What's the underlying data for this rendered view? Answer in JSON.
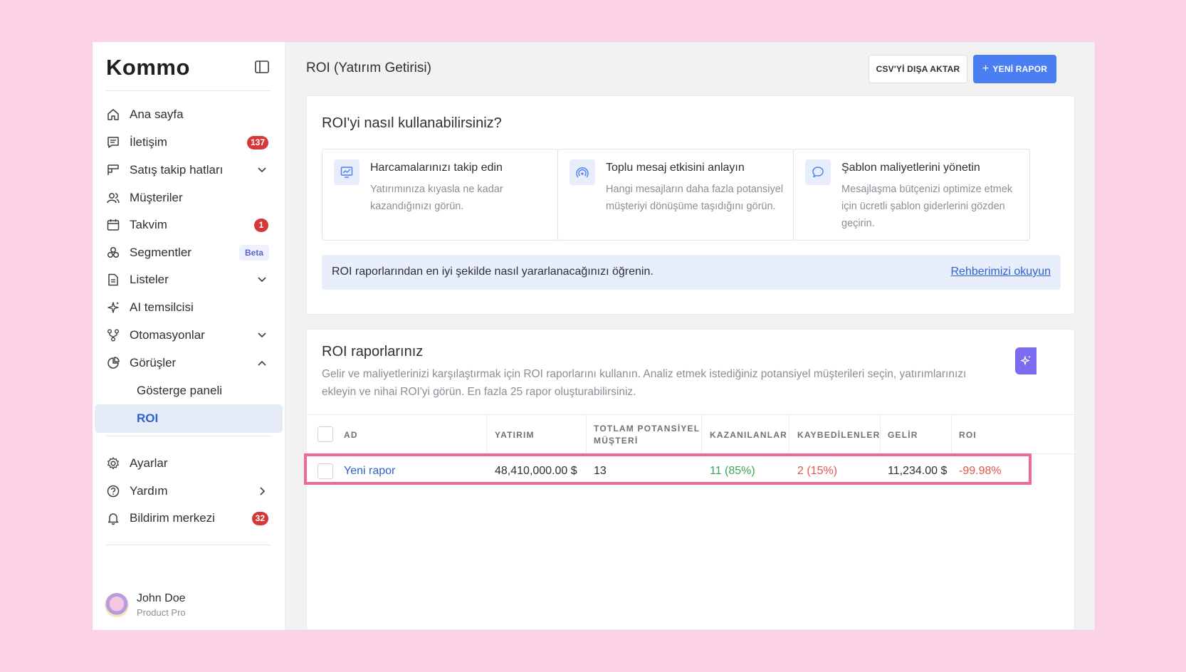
{
  "app": {
    "logo": "Kommo"
  },
  "sidebar": {
    "items": [
      {
        "label": "Ana sayfa",
        "icon": "home-icon"
      },
      {
        "label": "İletişim",
        "icon": "chat-icon",
        "badge": "137"
      },
      {
        "label": "Satış takip hatları",
        "icon": "pipeline-icon"
      },
      {
        "label": "Müşteriler",
        "icon": "users-icon"
      },
      {
        "label": "Takvim",
        "icon": "calendar-icon",
        "badge": "1"
      },
      {
        "label": "Segmentler",
        "icon": "segments-icon",
        "tag": "Beta"
      },
      {
        "label": "Listeler",
        "icon": "document-icon"
      },
      {
        "label": "AI temsilcisi",
        "icon": "sparkle-icon"
      },
      {
        "label": "Otomasyonlar",
        "icon": "automation-icon"
      },
      {
        "label": "Görüşler",
        "icon": "pie-chart-icon"
      },
      {
        "label": "Gösterge paneli"
      },
      {
        "label": "ROI"
      },
      {
        "label": "Ayarlar",
        "icon": "gear-icon"
      },
      {
        "label": "Yardım",
        "icon": "help-icon"
      },
      {
        "label": "Bildirim merkezi",
        "icon": "bell-icon",
        "badge": "32"
      }
    ],
    "user": {
      "name": "John Doe",
      "role": "Product Pro"
    }
  },
  "header": {
    "title": "ROI (Yatırım Getirisi)",
    "export_label": "CSV'Yİ DIŞA AKTAR",
    "new_report_label": "YENİ RAPOR"
  },
  "howto": {
    "title": "ROI'yi nasıl kullanabilirsiniz?",
    "features": [
      {
        "title": "Harcamalarınızı takip edin",
        "desc": "Yatırımınıza kıyasla ne kadar kazandığınızı görün.",
        "icon": "chart-monitor-icon"
      },
      {
        "title": "Toplu mesaj etkisini anlayın",
        "desc": "Hangi mesajların daha fazla potansiyel müşteriyi dönüşüme taşıdığını görün.",
        "icon": "broadcast-icon"
      },
      {
        "title": "Şablon maliyetlerini yönetin",
        "desc": "Mesajlaşma bütçenizi optimize etmek için ücretli şablon giderlerini gözden geçirin.",
        "icon": "speech-bubble-icon"
      }
    ],
    "info_text": "ROI raporlarından en iyi şekilde nasıl yararlanacağınızı öğrenin.",
    "info_link": "Rehberimizi okuyun"
  },
  "reports": {
    "title": "ROI raporlarınız",
    "description": "Gelir ve maliyetlerinizi karşılaştırmak için ROI raporlarını kullanın. Analiz etmek istediğiniz potansiyel müşterileri seçin, yatırımlarınızı ekleyin ve nihai ROI'yi görün. En fazla 25 rapor oluşturabilirsiniz.",
    "columns": [
      "AD",
      "YATIRIM",
      "TOTLAM POTANSİYEL MÜŞTERİ",
      "KAZANILANLAR",
      "KAYBEDİLENLER",
      "GELİR",
      "ROI"
    ],
    "rows": [
      {
        "name": "Yeni rapor",
        "investment": "48,410,000.00 $",
        "total": "13",
        "won": "11 (85%)",
        "lost": "2 (15%)",
        "revenue": "11,234.00 $",
        "roi": "-99.98%"
      }
    ]
  },
  "colors": {
    "accent": "#4a7ef2",
    "highlight": "#f0679e",
    "badge": "#d53838",
    "won": "#3aa655",
    "lost": "#e5534b"
  }
}
